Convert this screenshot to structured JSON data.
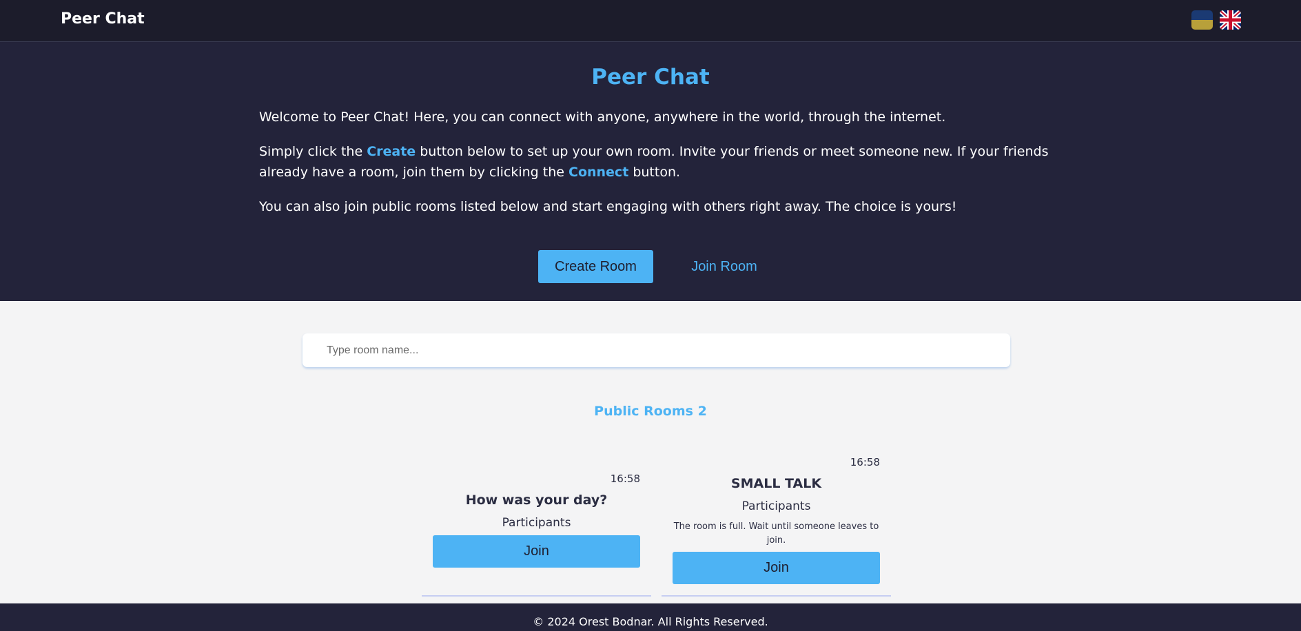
{
  "header": {
    "brand": "Peer Chat",
    "flags": [
      {
        "icon": "ukraine-flag-icon",
        "colors": [
          "#1b3a73",
          "#b8a03a"
        ]
      },
      {
        "icon": "uk-flag-icon",
        "colors": [
          "#012169",
          "#c8102e",
          "#ffffff"
        ]
      }
    ]
  },
  "hero": {
    "title": "Peer Chat",
    "p1": "Welcome to Peer Chat! Here, you can connect with anyone, anywhere in the world, through the internet.",
    "p2_before": "Simply click the ",
    "p2_create": "Create",
    "p2_middle": " button below to set up your own room. Invite your friends or meet someone new. If your friends already have a room, join them by clicking the ",
    "p2_connect": "Connect",
    "p2_after": " button.",
    "p3": "You can also join public rooms listed below and start engaging with others right away. The choice is yours!",
    "create_label": "Create Room",
    "join_label": "Join Room"
  },
  "search": {
    "placeholder": "Type room name..."
  },
  "rooms": {
    "title": "Public Rooms 2",
    "items": [
      {
        "time": "16:58",
        "name": "How was your day?",
        "participants": "Participants",
        "note": "",
        "join_label": "Join"
      },
      {
        "time": "16:58",
        "name": "SMALL TALK",
        "participants": "Participants",
        "note": "The room is full. Wait until someone leaves to join.",
        "join_label": "Join"
      }
    ]
  },
  "footer": {
    "text": "© 2024 Orest Bodnar. All Rights Reserved."
  },
  "colors": {
    "accent": "#4db3f4",
    "dark": "#23233a",
    "topbar": "#1c1c2b",
    "light_bg": "#f4f4f5"
  }
}
